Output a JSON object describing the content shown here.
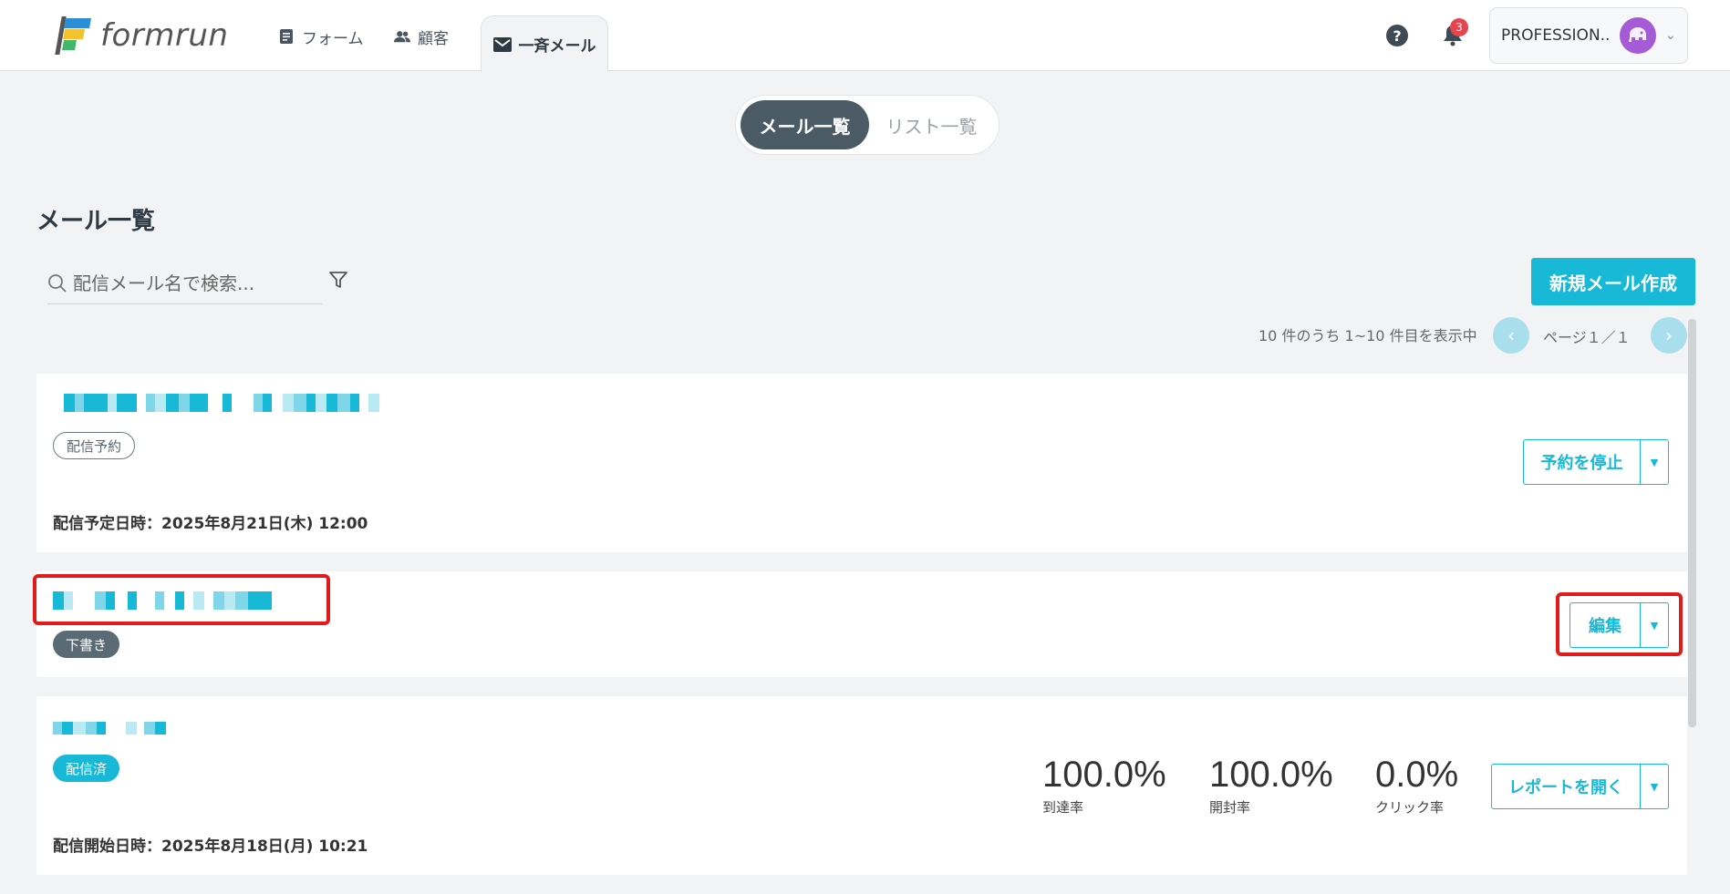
{
  "header": {
    "logo_text": "formrun",
    "nav": [
      {
        "label": "フォーム",
        "icon": "form-icon"
      },
      {
        "label": "顧客",
        "icon": "customers-icon"
      },
      {
        "label": "一斉メール",
        "icon": "mail-icon",
        "active": true
      }
    ],
    "help_icon": "?",
    "notification_count": "3",
    "account_name": "PROFESSION..."
  },
  "segment": {
    "active_label": "メール一覧",
    "inactive_label": "リスト一覧"
  },
  "page": {
    "title": "メール一覧",
    "search_placeholder": "配信メール名で検索...",
    "new_button_label": "新規メール作成",
    "pager_summary": "10 件のうち 1~10 件目を表示中",
    "page_label": "ページ１／１"
  },
  "colors": {
    "accent": "#18b9d7",
    "highlight": "#e11b1b"
  },
  "cards": [
    {
      "status": "配信予約",
      "meta": "配信予定日時：2025年8月21日(木) 12:00",
      "action_label": "予約を停止"
    },
    {
      "status": "下書き",
      "action_label": "編集"
    },
    {
      "status": "配信済",
      "meta": "配信開始日時：2025年8月18日(月) 10:21",
      "action_label": "レポートを開く",
      "stats": [
        {
          "value": "100.0%",
          "label": "到達率"
        },
        {
          "value": "100.0%",
          "label": "開封率"
        },
        {
          "value": "0.0%",
          "label": "クリック率"
        }
      ]
    }
  ]
}
